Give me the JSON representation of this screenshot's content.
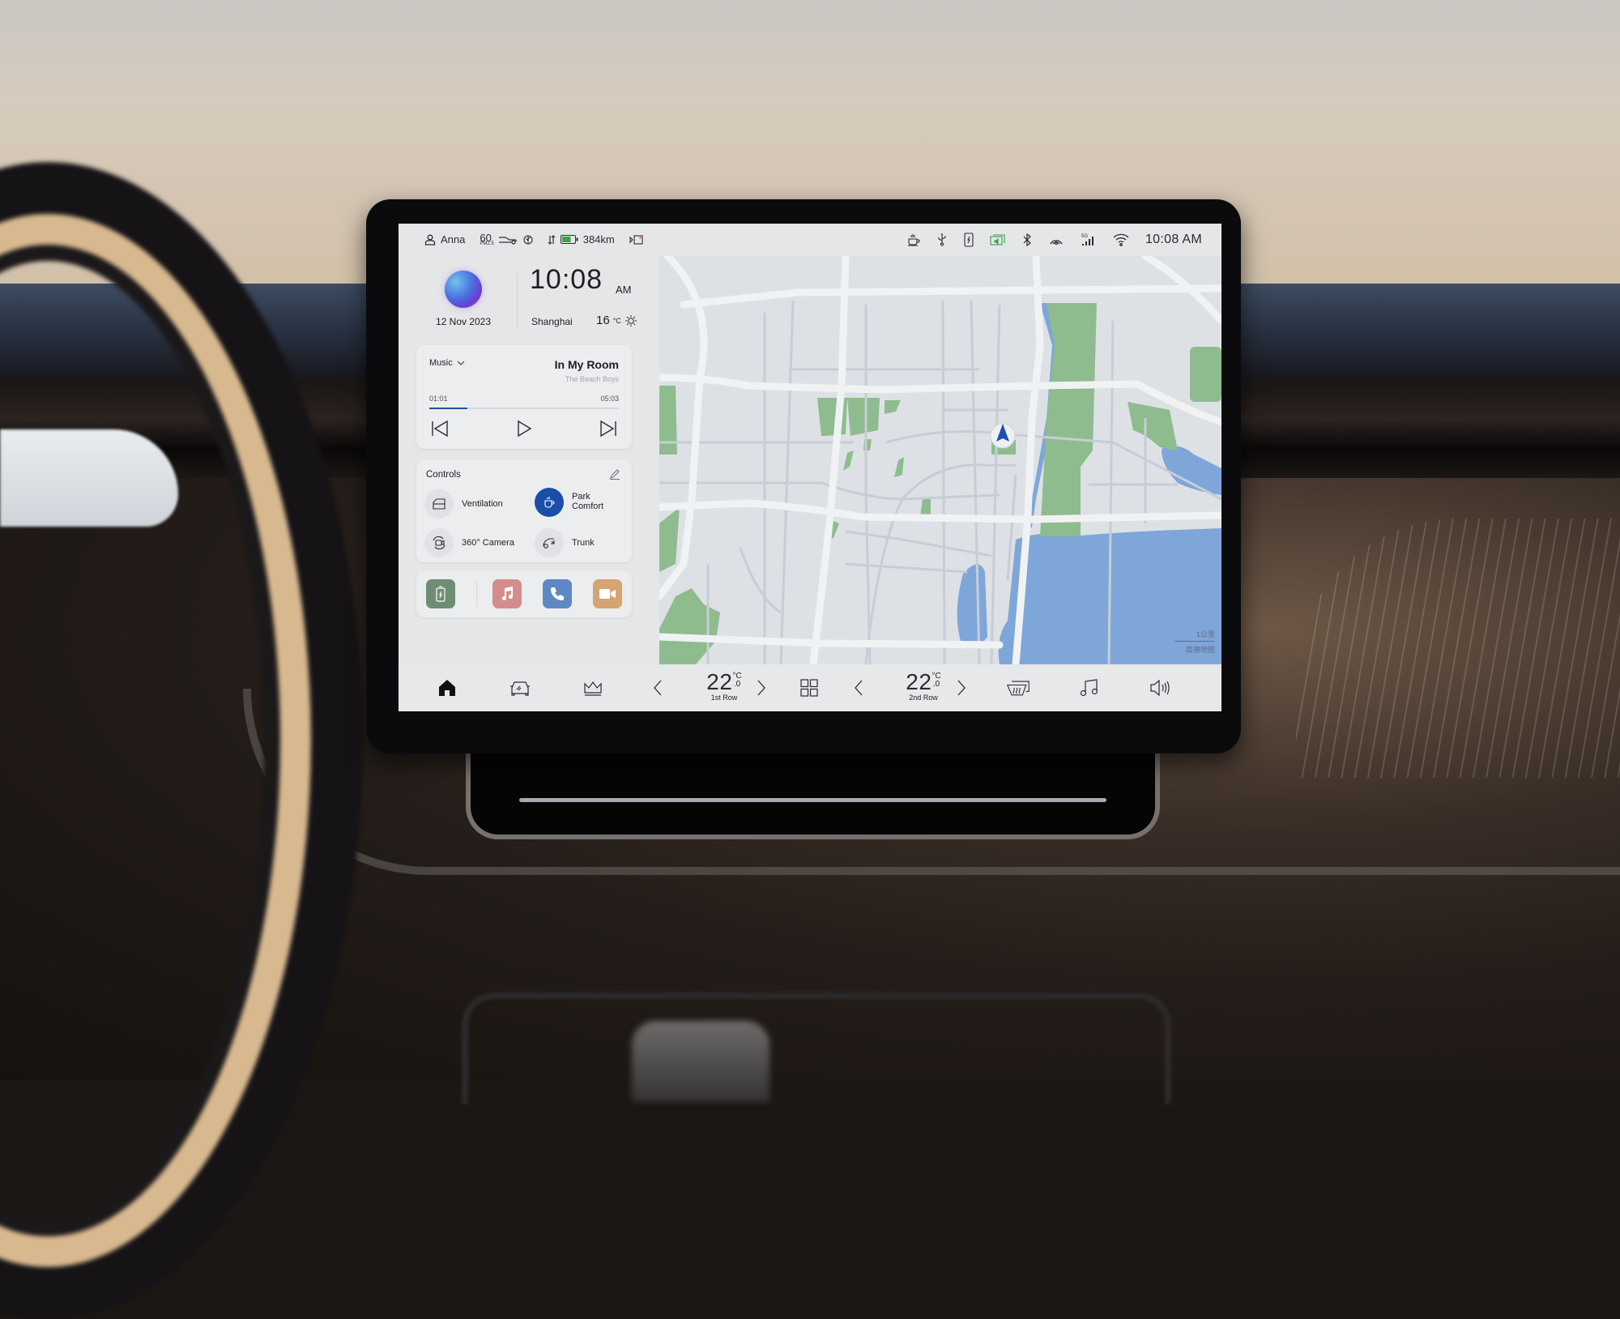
{
  "status_bar": {
    "user": "Anna",
    "air_quality": {
      "value": "60",
      "label": "PM2.5"
    },
    "range": "384km",
    "battery_level_pct": 70,
    "time": "10:08 AM",
    "right_icons": [
      "coffee-icon",
      "usb-icon",
      "phone-charging-icon",
      "screen-cast-icon",
      "bluetooth-icon",
      "hotspot-icon",
      "5g-signal-icon",
      "wifi-icon"
    ],
    "signal_label": "5G"
  },
  "clock_card": {
    "date": "12 Nov 2023",
    "time": "10:08",
    "ampm": "AM",
    "city": "Shanghai",
    "temperature": "16",
    "temp_unit": "°C",
    "weather_icon": "sun-icon"
  },
  "music": {
    "source_label": "Music",
    "song": "In My Room",
    "artist": "The Beach Boys",
    "current_time": "01:01",
    "total_time": "05:03",
    "progress_fraction": 0.2
  },
  "controls": {
    "title": "Controls",
    "items": [
      {
        "label": "Ventilation",
        "icon": "window-icon",
        "active": false
      },
      {
        "label": "Park\nComfort",
        "icon": "coffee-cup-icon",
        "active": true
      },
      {
        "label": "360° Camera",
        "icon": "camera-360-icon",
        "active": false
      },
      {
        "label": "Trunk",
        "icon": "trunk-icon",
        "active": false
      }
    ]
  },
  "dock": {
    "apps": [
      {
        "name": "Charging",
        "icon": "battery-charging-icon",
        "color": "#6f8d73"
      },
      {
        "name": "Music",
        "icon": "music-note-icon",
        "color": "#d38d8d"
      },
      {
        "name": "Phone",
        "icon": "phone-icon",
        "color": "#5e88c3"
      },
      {
        "name": "Video",
        "icon": "video-camera-icon",
        "color": "#d4a473"
      }
    ]
  },
  "map": {
    "scale_label": "1公里",
    "provider_label": "高德地图",
    "colors": {
      "land": "#dde1e5",
      "road": "#f1f2f3",
      "minor_road": "#c7cdd5",
      "park": "#8fbc8f",
      "water": "#7ea6d9",
      "arrow": "#1b4fb2"
    }
  },
  "nav_bar": {
    "items": [
      "home-icon",
      "car-icon",
      "crown-icon",
      "apps-grid-icon",
      "defrost-icon",
      "music-icon",
      "volume-icon"
    ],
    "climate": [
      {
        "value": "22",
        "decimal": ".0",
        "unit": "°C",
        "label": "1st Row"
      },
      {
        "value": "22",
        "decimal": ".0",
        "unit": "°C",
        "label": "2nd Row"
      }
    ]
  },
  "colors": {
    "accent": "#1a4ea8",
    "screen_bg": "#e4e6e8",
    "card_bg": "#ebedef"
  }
}
